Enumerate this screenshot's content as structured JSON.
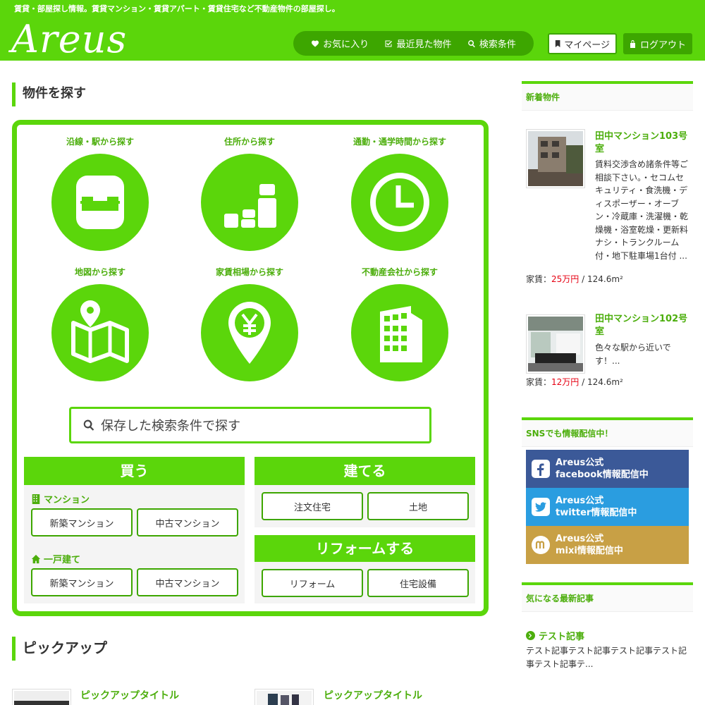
{
  "header": {
    "tagline": "賃貸・部屋探し情報。賃貸マンション・賃貸アパート・賃貸住宅など不動産物件の部屋探し。",
    "logo": "Areus",
    "nav": [
      {
        "label": "お気に入り",
        "icon": "heart-icon"
      },
      {
        "label": "最近見た物件",
        "icon": "check-square-icon"
      },
      {
        "label": "検索条件",
        "icon": "search-icon"
      }
    ],
    "mypage": "マイページ",
    "logout": "ログアウト"
  },
  "search": {
    "title": "物件を探す",
    "categories": [
      {
        "label": "沿線・駅から探す",
        "icon": "train-icon"
      },
      {
        "label": "住所から探す",
        "icon": "blocks-icon"
      },
      {
        "label": "通勤・通学時間から探す",
        "icon": "clock-icon"
      },
      {
        "label": "地図から探す",
        "icon": "map-icon"
      },
      {
        "label": "家賃相場から探す",
        "icon": "yen-pin-icon"
      },
      {
        "label": "不動産会社から探す",
        "icon": "building-icon"
      }
    ],
    "saved_search": "保存した検索条件で探す",
    "buy": {
      "head": "買う",
      "mansion_label": "マンション",
      "mansion_buttons": [
        "新築マンション",
        "中古マンション"
      ],
      "house_label": "一戸建て",
      "house_buttons": [
        "新築マンション",
        "中古マンション"
      ]
    },
    "build": {
      "head": "建てる",
      "buttons": [
        "注文住宅",
        "土地"
      ]
    },
    "reform": {
      "head": "リフォームする",
      "buttons": [
        "リフォーム",
        "住宅設備"
      ]
    }
  },
  "pickup": {
    "title": "ピックアップ",
    "items": [
      "ピックアップタイトル",
      "ピックアップタイトル"
    ]
  },
  "sidebar": {
    "new_title": "新着物件",
    "properties": [
      {
        "title": "田中マンション103号室",
        "desc": "賃料交渉含め諸条件等ご相談下さい。・セコムセキュリティ・食洗機・ディスポーザー・オーブン・冷蔵庫・洗濯機・乾燥機・浴室乾燥・更新料ナシ・トランクルーム付・地下駐車場1台付 ...",
        "price_label": "家賃：",
        "price": "25万円",
        "area": " / 124.6m²"
      },
      {
        "title": "田中マンション102号室",
        "desc": "色々な駅から近いです！...",
        "price_label": "家賃：",
        "price": "12万円",
        "area": " / 124.6m²"
      }
    ],
    "sns_title": "SNSでも情報配信中！",
    "sns": [
      {
        "line1": "Areus公式",
        "line2": "facebook情報配信中",
        "color": "#3b5998"
      },
      {
        "line1": "Areus公式",
        "line2": "twitter情報配信中",
        "color": "#2a9de0"
      },
      {
        "line1": "Areus公式",
        "line2": "mixi情報配信中",
        "color": "#c8a045"
      }
    ],
    "articles_title": "気になる最新記事",
    "article": {
      "title": "テスト記事",
      "text": "テスト記事テスト記事テスト記事テスト記事テスト記事テ..."
    }
  },
  "colors": {
    "brand": "#5bd60b",
    "brand_dark": "#3da600",
    "accent_text": "#4cae0c",
    "price_red": "#e60012"
  }
}
